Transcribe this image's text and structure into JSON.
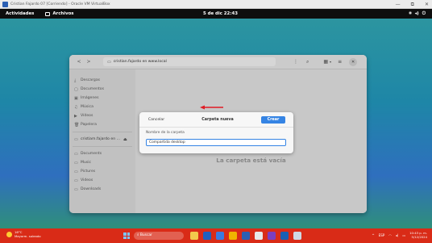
{
  "host_window": {
    "title": "Cristian Fajardo 07 [Corriendo] - Oracle VM VirtualBox",
    "controls": [
      "—",
      "⧉",
      "✕"
    ]
  },
  "topbar": {
    "activities": "Actividades",
    "app_name": "Archivos",
    "clock": "5 de dic 22:43",
    "status_icons": [
      "network-icon",
      "volume-icon",
      "power-icon"
    ]
  },
  "files": {
    "path": "cristian.fajardo en www.local",
    "sidebar": {
      "items": [
        {
          "label": "Descargas",
          "icon": "download-icon"
        },
        {
          "label": "Documentos",
          "icon": "document-icon"
        },
        {
          "label": "Imágenes",
          "icon": "image-icon"
        },
        {
          "label": "Música",
          "icon": "music-icon"
        },
        {
          "label": "Vídeos",
          "icon": "video-icon"
        },
        {
          "label": "Papelera",
          "icon": "trash-icon"
        },
        {
          "label": "cristiam.fajardo en ...",
          "icon": "network-drive-icon"
        },
        {
          "label": "Documents",
          "icon": "folder-icon"
        },
        {
          "label": "Music",
          "icon": "folder-icon"
        },
        {
          "label": "Pictures",
          "icon": "folder-icon"
        },
        {
          "label": "Videos",
          "icon": "folder-icon"
        },
        {
          "label": "Downloads",
          "icon": "folder-icon"
        }
      ]
    },
    "empty_message": "La carpeta está vacía"
  },
  "dialog": {
    "cancel_label": "Cancelar",
    "title": "Carpeta nueva",
    "create_label": "Crear",
    "field_label": "Nombre de la carpeta",
    "field_value": "Compartida desktop",
    "accent_color": "#3584e4",
    "arrow_color": "#e01b24"
  },
  "taskbar": {
    "weather_temp": "16°C",
    "weather_desc": "Mayorm. soleado",
    "search_placeholder": "Buscar",
    "time": "10:43 p. m.",
    "date": "5/12/2024",
    "tray_lang": "ESP"
  }
}
